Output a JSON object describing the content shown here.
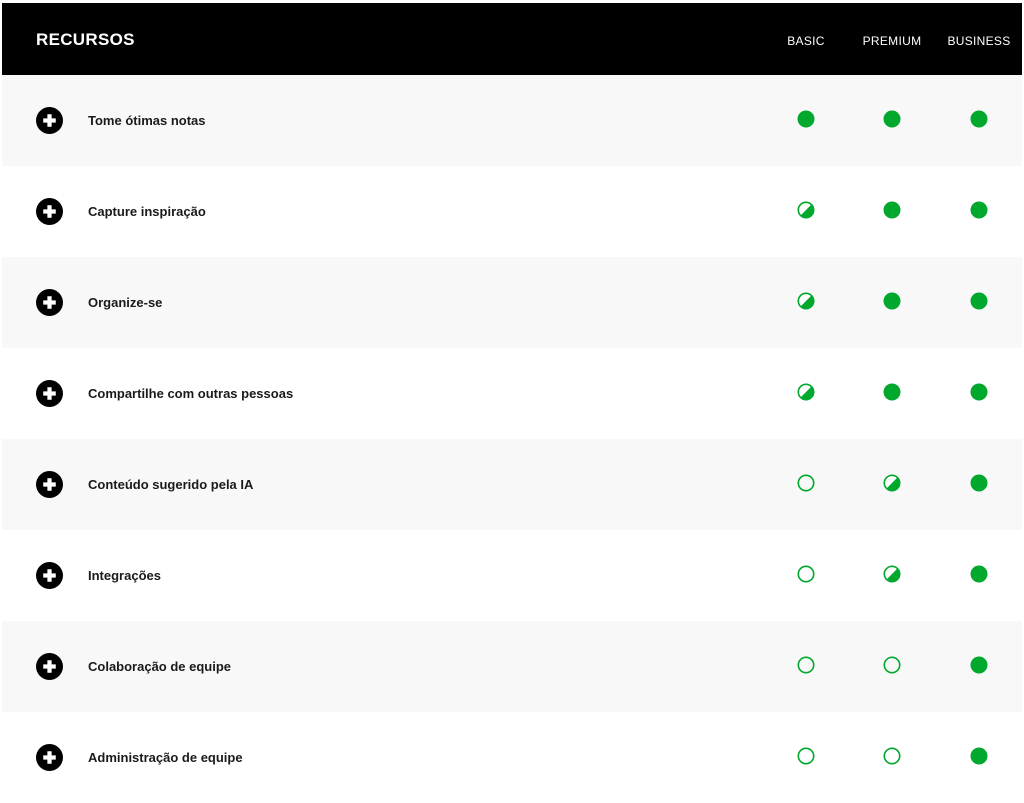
{
  "header": {
    "title": "RECURSOS",
    "plans": [
      "BASIC",
      "PREMIUM",
      "BUSINESS"
    ]
  },
  "colors": {
    "accent_green": "#00a82d",
    "header_bg": "#000000",
    "row_shaded": "#f8f8f8"
  },
  "icons": {
    "expand": "plus-circle-icon",
    "full": "filled-circle-icon",
    "partial": "half-circle-icon",
    "none": "empty-circle-icon"
  },
  "features": [
    {
      "label": "Tome ótimas notas",
      "basic": "full",
      "premium": "full",
      "business": "full"
    },
    {
      "label": "Capture inspiração",
      "basic": "partial",
      "premium": "full",
      "business": "full"
    },
    {
      "label": "Organize-se",
      "basic": "partial",
      "premium": "full",
      "business": "full"
    },
    {
      "label": "Compartilhe com outras pessoas",
      "basic": "partial",
      "premium": "full",
      "business": "full"
    },
    {
      "label": "Conteúdo sugerido pela IA",
      "basic": "none",
      "premium": "partial",
      "business": "full"
    },
    {
      "label": "Integrações",
      "basic": "none",
      "premium": "partial",
      "business": "full"
    },
    {
      "label": "Colaboração de equipe",
      "basic": "none",
      "premium": "none",
      "business": "full"
    },
    {
      "label": "Administração de equipe",
      "basic": "none",
      "premium": "none",
      "business": "full"
    }
  ]
}
